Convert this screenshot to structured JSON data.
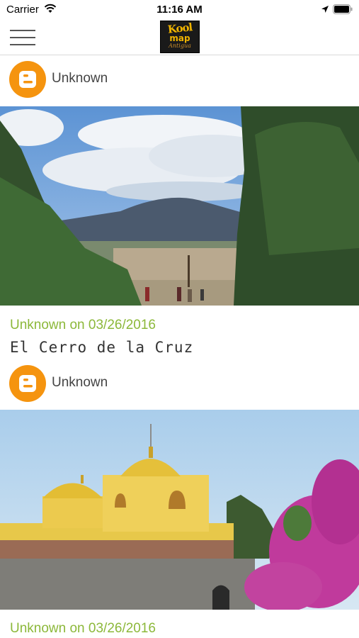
{
  "status_bar": {
    "carrier": "Carrier",
    "time": "11:16 AM",
    "icons": [
      "wifi-icon",
      "location-arrow-icon",
      "battery-icon"
    ]
  },
  "header": {
    "menu_icon": "hamburger-menu-icon",
    "logo": {
      "line1": "Kool",
      "line2": "map",
      "line3": "Antigua"
    }
  },
  "posts": [
    {
      "author": "Unknown",
      "author_icon": "blogger-icon",
      "image": "volcano-view-photo",
      "meta": "Unknown on 03/26/2016",
      "title": "El Cerro de la Cruz"
    },
    {
      "author": "Unknown",
      "author_icon": "blogger-icon",
      "image": "yellow-church-photo",
      "meta": "Unknown on 03/26/2016"
    }
  ],
  "colors": {
    "accent_green": "#8cb83a",
    "blogger_orange": "#f5940f",
    "logo_gold": "#f0b400"
  }
}
